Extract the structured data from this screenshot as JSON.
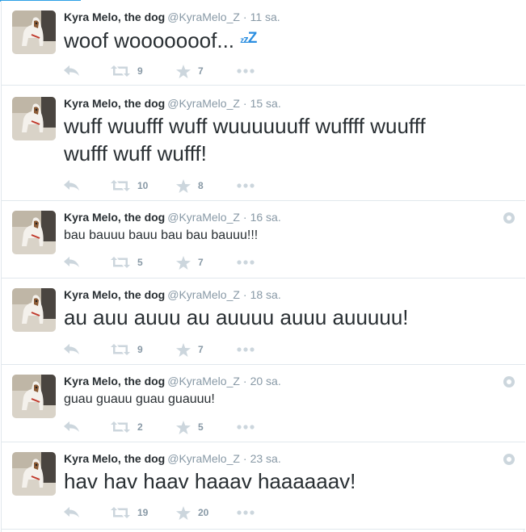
{
  "tweets": [
    {
      "fullname": "Kyra Melo, the dog",
      "username": "@KyraMelo_Z",
      "time": "11 sa.",
      "text": "woof wooooooof...",
      "emoji": "zzz",
      "retweets": "9",
      "favorites": "7",
      "has_menu": false
    },
    {
      "fullname": "Kyra Melo, the dog",
      "username": "@KyraMelo_Z",
      "time": "15 sa.",
      "line1": "wuff wuufff wuff wuuuuuuff wuffff wuufff",
      "line2": "wufff wuff wufff!",
      "retweets": "10",
      "favorites": "8",
      "has_menu": false
    },
    {
      "fullname": "Kyra Melo, the dog",
      "username": "@KyraMelo_Z",
      "time": "16 sa.",
      "text": "bau bauuu bauu bau bau bauuu!!!",
      "retweets": "5",
      "favorites": "7",
      "has_menu": true
    },
    {
      "fullname": "Kyra Melo, the dog",
      "username": "@KyraMelo_Z",
      "time": "18 sa.",
      "text": "au auu auuu au auuuu auuu auuuuu!",
      "retweets": "9",
      "favorites": "7",
      "has_menu": false
    },
    {
      "fullname": "Kyra Melo, the dog",
      "username": "@KyraMelo_Z",
      "time": "20 sa.",
      "text": "guau guauu guau guauuu!",
      "retweets": "2",
      "favorites": "5",
      "has_menu": true
    },
    {
      "fullname": "Kyra Melo, the dog",
      "username": "@KyraMelo_Z",
      "time": "23 sa.",
      "text": "hav hav haav haaav haaaaaav!",
      "retweets": "19",
      "favorites": "20",
      "has_menu": true
    }
  ],
  "dot": "·",
  "colors": {
    "accent": "#2b8ee0",
    "muted": "#8899a6",
    "text": "#292f33",
    "border": "#e1e8ed"
  },
  "icons": {
    "reply": "reply-icon",
    "retweet": "retweet-icon",
    "favorite": "star-icon",
    "more": "more-dots-icon",
    "menu": "tweet-menu-gear-icon"
  }
}
